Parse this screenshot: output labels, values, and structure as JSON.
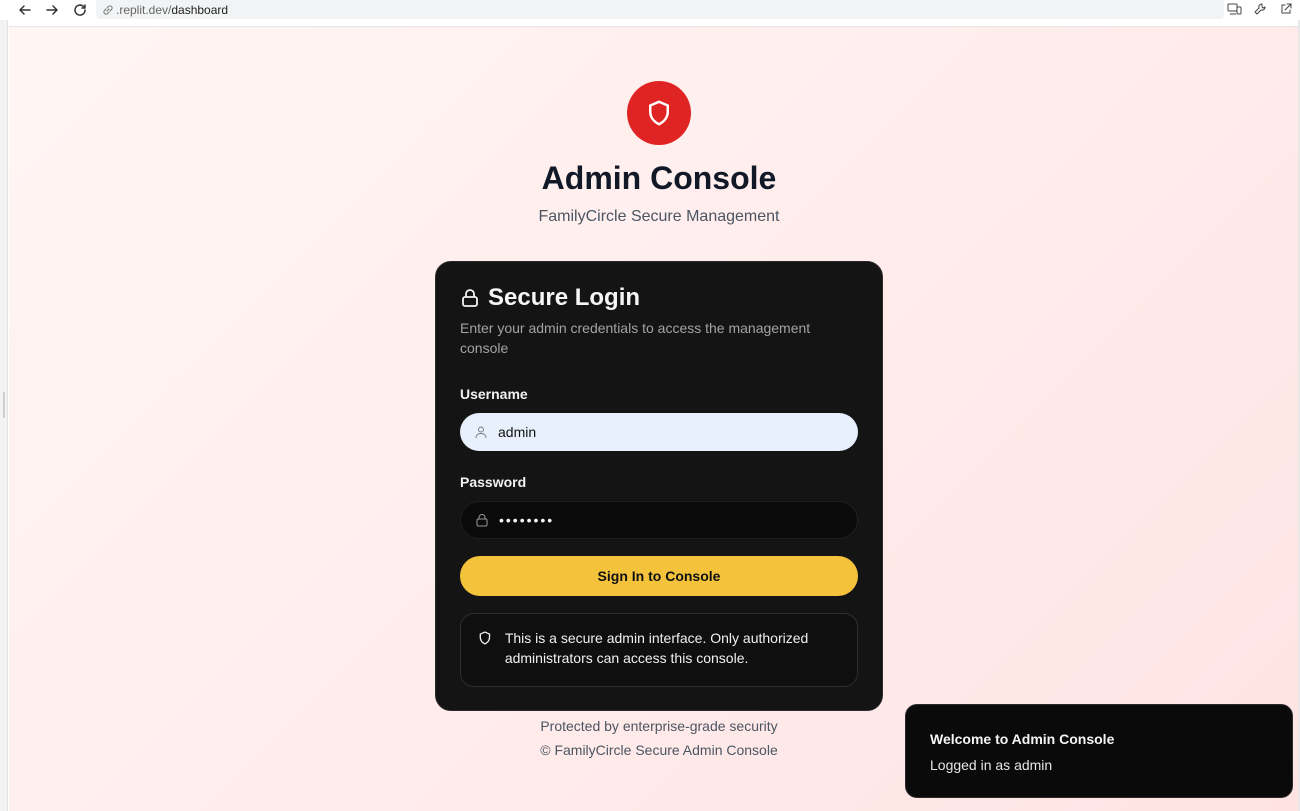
{
  "browser": {
    "url_host": ".replit.dev/",
    "url_path": "dashboard"
  },
  "header": {
    "title": "Admin Console",
    "subtitle": "FamilyCircle Secure Management"
  },
  "login_card": {
    "title": "Secure Login",
    "description": "Enter your admin credentials to access the management console",
    "username_label": "Username",
    "username_value": "admin",
    "password_label": "Password",
    "password_value": "••••••••",
    "submit_label": "Sign In to Console",
    "notice": "This is a secure admin interface. Only authorized administrators can access this console."
  },
  "footer": {
    "line1": "Protected by enterprise-grade security",
    "line2": "© FamilyCircle Secure Admin Console"
  },
  "toast": {
    "title": "Welcome to Admin Console",
    "message": "Logged in as admin"
  },
  "colors": {
    "brand_red": "#e02424",
    "button_yellow": "#f5c33b",
    "card_bg": "#141414",
    "page_bg": "#ffecea"
  },
  "icons": [
    "back-arrow-icon",
    "forward-arrow-icon",
    "reload-icon",
    "link-icon",
    "devices-icon",
    "wrench-icon",
    "external-link-icon",
    "shield-icon",
    "lock-icon",
    "user-icon"
  ]
}
